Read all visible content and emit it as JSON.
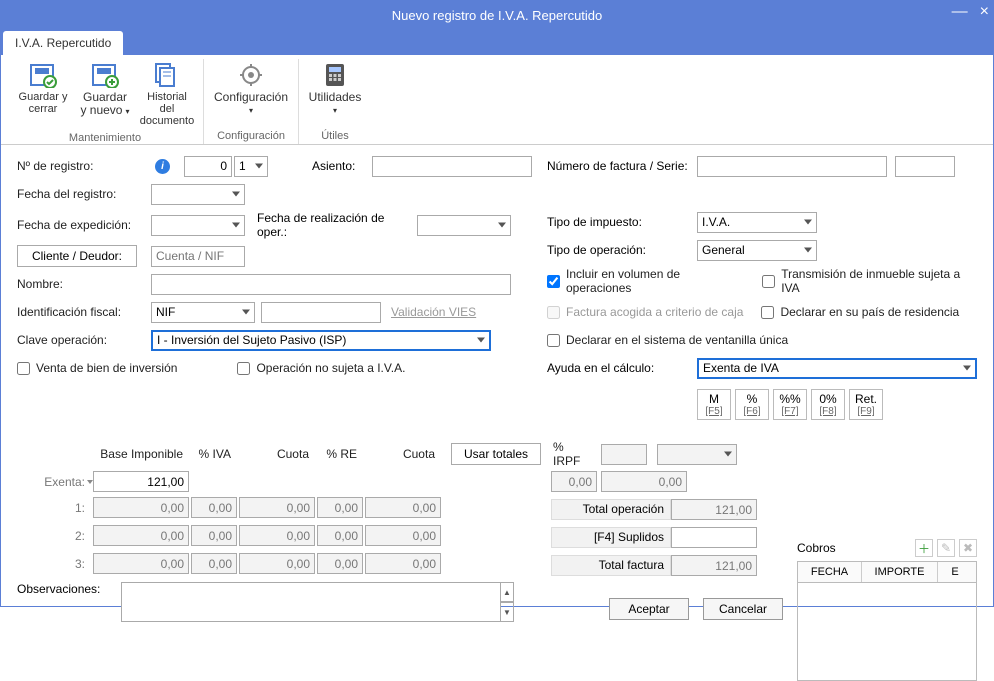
{
  "window": {
    "title": "Nuevo registro de I.V.A. Repercutido"
  },
  "tab": {
    "label": "I.V.A. Repercutido"
  },
  "ribbon": {
    "groups": [
      {
        "label": "Mantenimiento",
        "items": [
          "Guardar y cerrar",
          "Guardar y nuevo",
          "Historial del documento"
        ]
      },
      {
        "label": "Configuración",
        "items": [
          "Configuración"
        ]
      },
      {
        "label": "Útiles",
        "items": [
          "Utilidades"
        ]
      }
    ]
  },
  "labels": {
    "num_registro": "Nº de registro:",
    "asiento": "Asiento:",
    "numero_factura": "Número de factura / Serie:",
    "fecha_registro": "Fecha del registro:",
    "fecha_expedicion": "Fecha de expedición:",
    "fecha_realizacion": "Fecha de realización de oper.:",
    "cliente_deudor": "Cliente / Deudor:",
    "cuenta_nif_ph": "Cuenta / NIF",
    "nombre": "Nombre:",
    "ident_fiscal": "Identificación fiscal:",
    "validacion_vies": "Validación VIES",
    "clave_operacion": "Clave operación:",
    "clave_operacion_val": "I - Inversión del Sujeto Pasivo (ISP)",
    "venta_bien_inv": "Venta de bien de inversión",
    "op_no_sujeta": "Operación no sujeta a I.V.A.",
    "tipo_impuesto": "Tipo de impuesto:",
    "tipo_impuesto_val": "I.V.A.",
    "tipo_operacion": "Tipo de operación:",
    "tipo_operacion_val": "General",
    "incluir_volumen": "Incluir en volumen de operaciones",
    "trans_inmueble": "Transmisión de inmueble sujeta a IVA",
    "factura_caja": "Factura acogida a criterio de caja",
    "declarar_pais": "Declarar en su país de residencia",
    "declarar_ventanilla": "Declarar en el sistema de ventanilla única",
    "ayuda_calculo": "Ayuda en el cálculo:",
    "ayuda_calculo_val": "Exenta de IVA",
    "nif_val": "NIF",
    "num_reg_val": "0",
    "num_reg_sub": "1"
  },
  "help_buttons": [
    {
      "main": "M",
      "sub": "[F5]"
    },
    {
      "main": "%",
      "sub": "[F6]"
    },
    {
      "main": "%%",
      "sub": "[F7]"
    },
    {
      "main": "0%",
      "sub": "[F8]"
    },
    {
      "main": "Ret.",
      "sub": "[F9]"
    }
  ],
  "grid": {
    "headers": {
      "base": "Base Imponible",
      "pct_iva": "% IVA",
      "cuota1": "Cuota",
      "pct_re": "% RE",
      "cuota2": "Cuota",
      "usar_totales": "Usar totales",
      "pct_irpf": "% IRPF"
    },
    "rows": [
      {
        "label": "Exenta:",
        "base": "121,00",
        "iva": "",
        "cuota1": "",
        "re": "",
        "cuota2": ""
      },
      {
        "label": "1:",
        "base": "0,00",
        "iva": "0,00",
        "cuota1": "0,00",
        "re": "0,00",
        "cuota2": "0,00"
      },
      {
        "label": "2:",
        "base": "0,00",
        "iva": "0,00",
        "cuota1": "0,00",
        "re": "0,00",
        "cuota2": "0,00"
      },
      {
        "label": "3:",
        "base": "0,00",
        "iva": "0,00",
        "cuota1": "0,00",
        "re": "0,00",
        "cuota2": "0,00"
      }
    ],
    "irpf_val1": "0,00",
    "irpf_val2": "0,00",
    "totals": {
      "operacion_lbl": "Total operación",
      "operacion_val": "121,00",
      "suplidos_lbl": "[F4] Suplidos",
      "suplidos_val": "",
      "factura_lbl": "Total factura",
      "factura_val": "121,00"
    }
  },
  "observaciones": {
    "label": "Observaciones:",
    "value": ""
  },
  "cobros": {
    "title": "Cobros",
    "cols": {
      "fecha": "FECHA",
      "importe": "IMPORTE",
      "e": "E"
    }
  },
  "footer": {
    "aceptar": "Aceptar",
    "cancelar": "Cancelar"
  }
}
